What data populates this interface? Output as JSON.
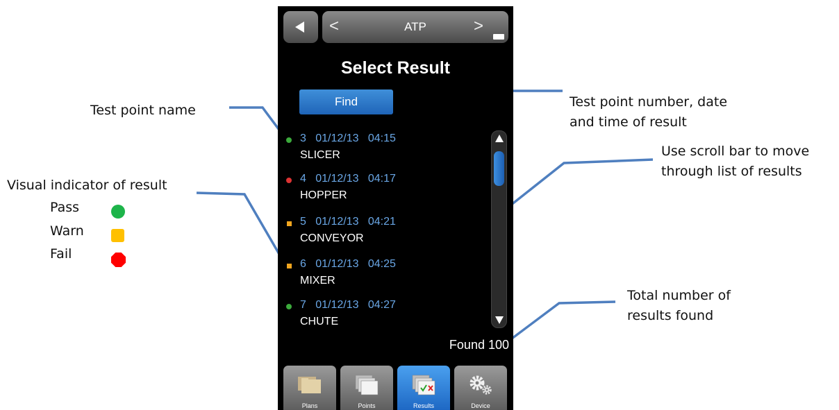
{
  "annotations": {
    "test_point_name": "Test point name",
    "test_point_number_line1": "Test point number, date",
    "test_point_number_line2": "and time of result",
    "scroll_line1": "Use scroll bar to move",
    "scroll_line2": "through list of results",
    "visual_indicator": "Visual indicator of result",
    "total_line1": "Total number of",
    "total_line2": "results found",
    "legend": [
      {
        "label": "Pass",
        "color": "#1db44a"
      },
      {
        "label": "Warn",
        "color": "#ffc000"
      },
      {
        "label": "Fail",
        "color": "#ff0000"
      }
    ]
  },
  "header": {
    "nav_prev": "<",
    "title": "ATP",
    "nav_next": ">"
  },
  "page_title": "Select Result",
  "find_label": "Find",
  "results": [
    {
      "status": "pass",
      "line": "3   01/12/13   04:15",
      "name": "SLICER"
    },
    {
      "status": "fail",
      "line": "4   01/12/13   04:17",
      "name": "HOPPER"
    },
    {
      "status": "warn",
      "line": "5   01/12/13   04:21",
      "name": "CONVEYOR"
    },
    {
      "status": "warn",
      "line": "6   01/12/13   04:25",
      "name": "MIXER"
    },
    {
      "status": "pass",
      "line": "7   01/12/13   04:27",
      "name": "CHUTE"
    }
  ],
  "found_text": "Found 100",
  "tabs": [
    {
      "label": "Plans",
      "icon": "plans-folder-icon"
    },
    {
      "label": "Points",
      "icon": "points-pages-icon"
    },
    {
      "label": "Results",
      "icon": "results-check-icon"
    },
    {
      "label": "Device",
      "icon": "gear-icon"
    }
  ],
  "colors": {
    "accent_blue": "#2a7dd6",
    "result_text_blue": "#6aa7e6",
    "callout_line": "#4a7ab5"
  }
}
